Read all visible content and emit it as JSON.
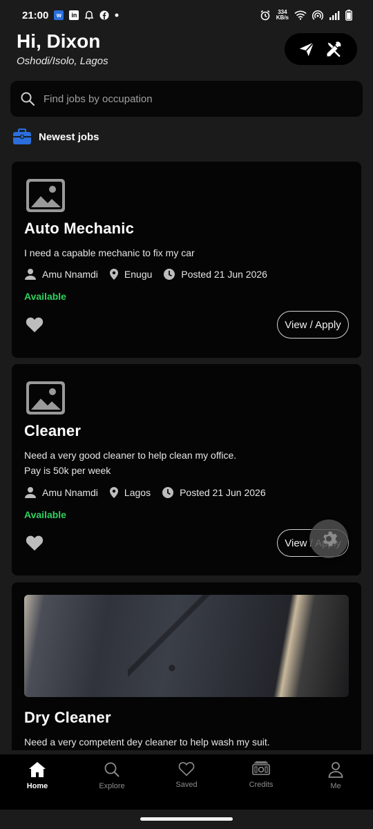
{
  "status_bar": {
    "time": "21:00",
    "net_speed_value": "334",
    "net_speed_unit": "KB/s",
    "icons": [
      "w-app-icon",
      "linkedin-icon",
      "notification-icon",
      "facebook-icon",
      "dot-icon",
      "alarm-icon",
      "wifi-icon",
      "hotspot-icon",
      "signal-icon",
      "battery-icon"
    ]
  },
  "header": {
    "greeting": "Hi, Dixon",
    "location": "Oshodi/Isolo, Lagos",
    "actions": [
      "send-icon",
      "tools-icon"
    ]
  },
  "search": {
    "placeholder": "Find jobs by occupation"
  },
  "section": {
    "title": "Newest jobs",
    "icon": "briefcase-icon"
  },
  "jobs": [
    {
      "title": "Auto Mechanic",
      "desc_lines": [
        "I need a capable mechanic to fix my car"
      ],
      "poster": "Amu Nnamdi",
      "location": "Enugu",
      "posted": "Posted 21 Jun 2026",
      "status": "Available",
      "cta": "View / Apply"
    },
    {
      "title": "Cleaner",
      "desc_lines": [
        "Need a very good cleaner to help clean my office.",
        "Pay is 50k per week"
      ],
      "poster": "Amu Nnamdi",
      "location": "Lagos",
      "posted": "Posted 21 Jun 2026",
      "status": "Available",
      "cta": "View / Apply"
    },
    {
      "title": "Dry Cleaner",
      "desc_lines": [
        "Need a very competent dey cleaner to help wash my suit."
      ]
    }
  ],
  "bottom_nav": [
    {
      "label": "Home",
      "icon": "home-icon",
      "active": true
    },
    {
      "label": "Explore",
      "icon": "search-icon",
      "active": false
    },
    {
      "label": "Saved",
      "icon": "heart-icon",
      "active": false
    },
    {
      "label": "Credits",
      "icon": "money-icon",
      "active": false
    },
    {
      "label": "Me",
      "icon": "person-icon",
      "active": false
    }
  ],
  "colors": {
    "background": "#1b1b1c",
    "card": "#050505",
    "available": "#2fd15e",
    "brand_blue": "#2a6fdb"
  }
}
